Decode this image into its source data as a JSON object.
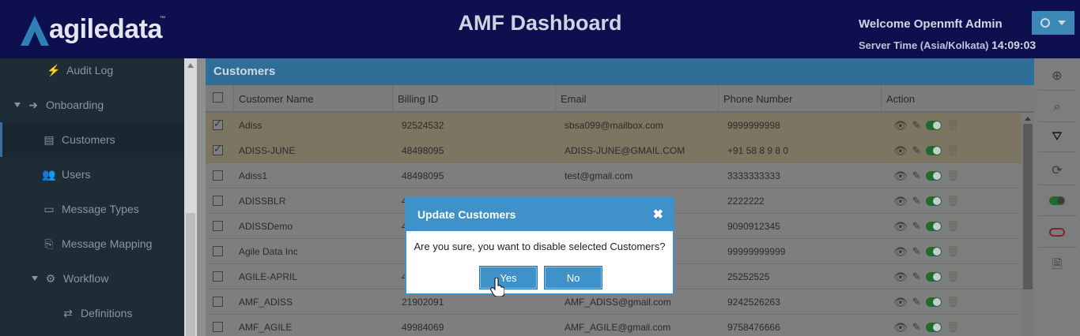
{
  "header": {
    "logo_text": "agiledata",
    "logo_tm": "™",
    "title": "AMF Dashboard",
    "welcome": "Welcome Openmft Admin",
    "server_time_label": "Server Time (Asia/Kolkata)",
    "server_time_value": "14:09:03"
  },
  "sidebar": {
    "items": [
      {
        "label": "Audit Log",
        "icon": "bolt-icon"
      },
      {
        "label": "Onboarding",
        "icon": "sign-in-icon"
      },
      {
        "label": "Customers",
        "icon": "id-card-icon"
      },
      {
        "label": "Users",
        "icon": "users-icon"
      },
      {
        "label": "Message Types",
        "icon": "envelope-icon"
      },
      {
        "label": "Message Mapping",
        "icon": "file-code-icon"
      },
      {
        "label": "Workflow",
        "icon": "gear-icon"
      },
      {
        "label": "Definitions",
        "icon": "exchange-icon"
      }
    ]
  },
  "panel": {
    "title": "Customers",
    "columns": [
      "Customer Name",
      "Billing ID",
      "Email",
      "Phone Number",
      "Action"
    ],
    "rows": [
      {
        "name": "Adiss",
        "billing": "92524532",
        "email": "sbsa099@mailbox.com",
        "phone": "9999999998",
        "checked": true
      },
      {
        "name": "ADISS-JUNE",
        "billing": "48498095",
        "email": "ADISS-JUNE@GMAIL.COM",
        "phone": "+91 58 8 9 8 0",
        "checked": true
      },
      {
        "name": "Adiss1",
        "billing": "48498095",
        "email": "test@gmail.com",
        "phone": "3333333333",
        "checked": false
      },
      {
        "name": "ADISSBLR",
        "billing": "4",
        "email": "",
        "phone": "2222222",
        "checked": false
      },
      {
        "name": "ADISSDemo",
        "billing": "4",
        "email": "",
        "phone": "9090912345",
        "checked": false
      },
      {
        "name": "Agile Data Inc",
        "billing": "",
        "email": "",
        "phone": "99999999999",
        "checked": false
      },
      {
        "name": "AGILE-APRIL",
        "billing": "4",
        "email": "",
        "phone": "25252525",
        "checked": false
      },
      {
        "name": "AMF_ADISS",
        "billing": "21902091",
        "email": "AMF_ADISS@gmail.com",
        "phone": "9242526263",
        "checked": false
      },
      {
        "name": "AMF_AGILE",
        "billing": "49984069",
        "email": "AMF_AGILE@gmail.com",
        "phone": "9758476666",
        "checked": false
      }
    ]
  },
  "toolbar": {
    "tools": [
      "plus-circle-icon",
      "search-icon",
      "filter-icon",
      "refresh-icon",
      "toggle-on-icon",
      "toggle-off-icon",
      "export-file-icon"
    ]
  },
  "modal": {
    "title": "Update Customers",
    "message": "Are you sure, you want to disable selected Customers?",
    "yes_label": "Yes",
    "no_label": "No"
  },
  "colors": {
    "header_bg": "#0d0f4e",
    "accent": "#3e92c9",
    "sidebar_bg": "#1e2d35"
  }
}
